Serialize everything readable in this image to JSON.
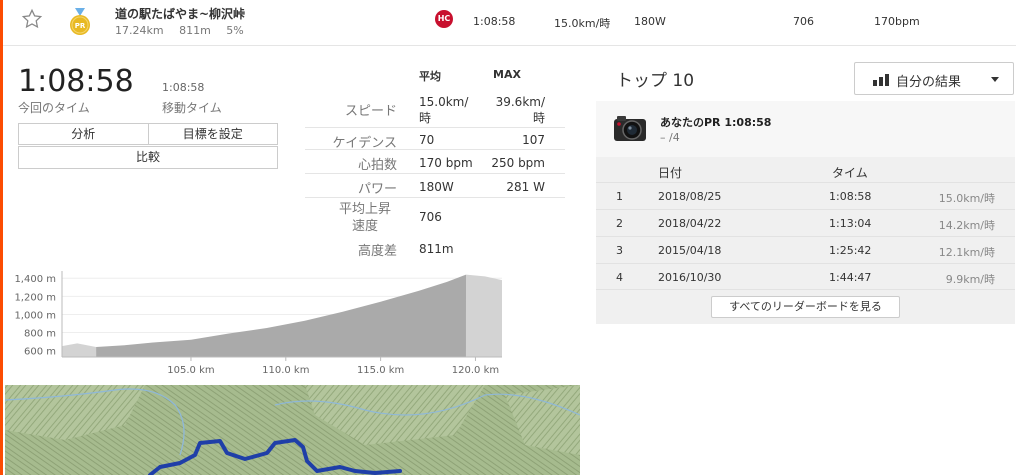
{
  "segment": {
    "name": "道の駅たばやま~柳沢峠",
    "distance": "17.24km",
    "elevation": "811m",
    "grade": "5%",
    "category_badge": "HC",
    "medal_label": "PR",
    "time": "1:08:58",
    "speed": "15.0km/時",
    "power": "180W",
    "vam": "706",
    "heartrate": "170bpm"
  },
  "summary": {
    "elapsed_time": "1:08:58",
    "elapsed_label": "今回のタイム",
    "moving_time": "1:08:58",
    "moving_label": "移動タイム",
    "analyze_label": "分析",
    "goal_label": "目標を設定",
    "compare_label": "比較"
  },
  "stats": {
    "header_avg": "平均",
    "header_max": "MAX",
    "rows": [
      {
        "label": "スピード",
        "avg": "15.0km/時",
        "max": "39.6km/時"
      },
      {
        "label": "ケイデンス",
        "avg": "70",
        "max": "107"
      },
      {
        "label": "心拍数",
        "avg": "170 bpm",
        "max": "250 bpm"
      },
      {
        "label": "パワー",
        "avg": "180W",
        "max": "281 W"
      },
      {
        "label": "平均上昇速度",
        "avg": "706",
        "max": ""
      },
      {
        "label": "高度差",
        "avg": "811m",
        "max": ""
      }
    ]
  },
  "chart_data": {
    "type": "area",
    "title": "",
    "xlabel": "",
    "ylabel": "",
    "x_ticks": [
      "105.0 km",
      "110.0 km",
      "115.0 km",
      "120.0 km"
    ],
    "x_tick_values": [
      105,
      110,
      115,
      120
    ],
    "y_ticks": [
      "600 m",
      "800 m",
      "1,000 m",
      "1,200 m",
      "1,400 m"
    ],
    "y_tick_values": [
      600,
      800,
      1000,
      1200,
      1400
    ],
    "xlim": [
      98.2,
      121.4
    ],
    "ylim": [
      530,
      1480
    ],
    "segment_range": [
      100,
      119.5
    ],
    "x": [
      98.2,
      99.0,
      100.0,
      101.5,
      103.0,
      105.0,
      107.0,
      109.0,
      111.0,
      113.0,
      115.0,
      117.0,
      118.5,
      119.5,
      120.5,
      121.4
    ],
    "values": [
      650,
      680,
      640,
      660,
      690,
      720,
      790,
      850,
      930,
      1030,
      1140,
      1260,
      1360,
      1440,
      1420,
      1380
    ],
    "grid": true,
    "colors": {
      "segment": "#aaaaaa",
      "outside": "#d3d3d3"
    }
  },
  "top10": {
    "title": "トップ 10",
    "filter_label": "自分の結果",
    "pr_title": "あなたのPR 1:08:58",
    "pr_rank": "– /4",
    "col_date": "日付",
    "col_time": "タイム",
    "rows": [
      {
        "rank": "1",
        "date": "2018/08/25",
        "time": "1:08:58",
        "speed": "15.0km/時"
      },
      {
        "rank": "2",
        "date": "2018/04/22",
        "time": "1:13:04",
        "speed": "14.2km/時"
      },
      {
        "rank": "3",
        "date": "2015/04/18",
        "time": "1:25:42",
        "speed": "12.1km/時"
      },
      {
        "rank": "4",
        "date": "2016/10/30",
        "time": "1:44:47",
        "speed": "9.9km/時"
      }
    ],
    "see_all_label": "すべてのリーダーボードを見る"
  },
  "colors": {
    "accent": "#fc4c02",
    "hc_badge": "#c8102e",
    "medal": "#e8b923",
    "route": "#1f3fa8",
    "map_terrain": "#9fb587"
  }
}
